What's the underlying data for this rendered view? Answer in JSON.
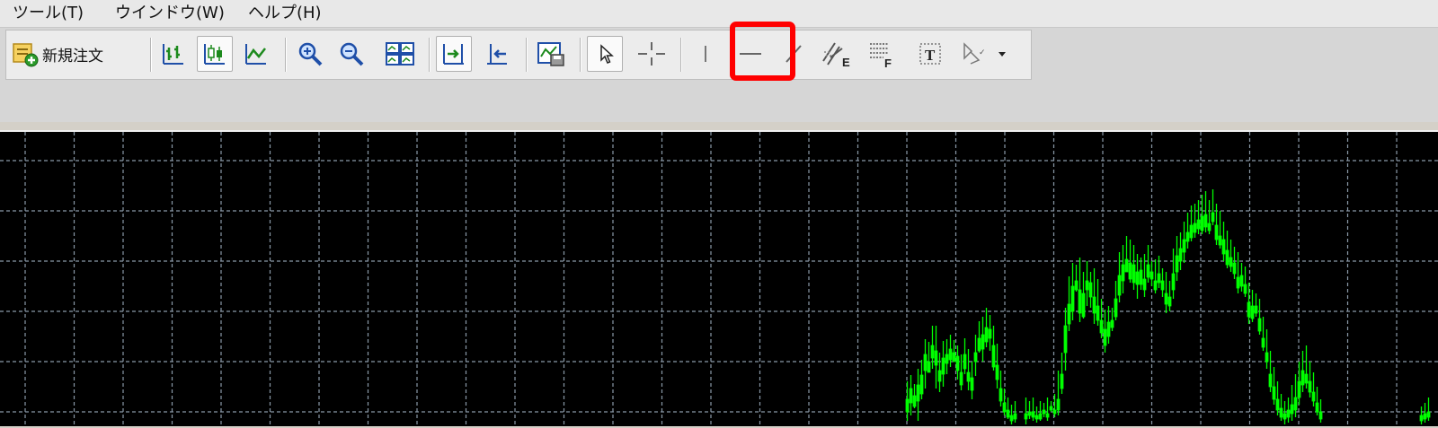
{
  "menu": {
    "items": [
      {
        "label": "ツール(T)"
      },
      {
        "label": "ウインドウ(W)"
      },
      {
        "label": "ヘルプ(H)"
      }
    ]
  },
  "toolbar": {
    "new_order_label": "新規注文",
    "buttons": [
      {
        "name": "bar-chart-icon",
        "pressed": false
      },
      {
        "name": "candlestick-chart-icon",
        "pressed": true
      },
      {
        "name": "line-chart-icon",
        "pressed": false
      },
      {
        "name": "zoom-in-icon",
        "pressed": false
      },
      {
        "name": "zoom-out-icon",
        "pressed": false
      },
      {
        "name": "tile-windows-icon",
        "pressed": false
      },
      {
        "name": "chart-shift-icon",
        "pressed": true
      },
      {
        "name": "auto-scroll-icon",
        "pressed": false
      },
      {
        "name": "templates-icon",
        "pressed": false
      },
      {
        "name": "cursor-icon",
        "pressed": true
      },
      {
        "name": "crosshair-icon",
        "pressed": false
      },
      {
        "name": "vertical-line-icon",
        "pressed": false
      },
      {
        "name": "horizontal-line-icon",
        "pressed": false,
        "highlighted": true
      },
      {
        "name": "trendline-icon",
        "pressed": false
      },
      {
        "name": "equidistant-channel-icon",
        "pressed": false
      },
      {
        "name": "fibonacci-retracement-icon",
        "pressed": false
      },
      {
        "name": "text-label-icon",
        "pressed": false
      },
      {
        "name": "arrows-dropdown-icon",
        "pressed": false
      }
    ]
  },
  "colors": {
    "chart_background": "#000000",
    "grid": "#8a99a8",
    "bull_candle": "#00ff00",
    "bear_candle": "#000000",
    "highlight": "#ff0000"
  },
  "chart": {
    "candles": [
      [
        1008,
        4,
        14,
        28,
        48
      ],
      [
        1012,
        10,
        24,
        40,
        55
      ],
      [
        1016,
        18,
        20,
        32,
        45
      ],
      [
        1020,
        4,
        26,
        44,
        62
      ],
      [
        1024,
        28,
        34,
        55,
        72
      ],
      [
        1028,
        40,
        60,
        78,
        95
      ],
      [
        1032,
        60,
        58,
        70,
        92
      ],
      [
        1036,
        62,
        74,
        88,
        110
      ],
      [
        1040,
        40,
        66,
        82,
        110
      ],
      [
        1044,
        36,
        48,
        60,
        80
      ],
      [
        1048,
        42,
        56,
        74,
        93
      ],
      [
        1052,
        56,
        68,
        78,
        95
      ],
      [
        1056,
        64,
        72,
        84,
        100
      ],
      [
        1060,
        70,
        70,
        80,
        94
      ],
      [
        1064,
        50,
        60,
        76,
        88
      ],
      [
        1068,
        38,
        44,
        58,
        78
      ],
      [
        1072,
        56,
        62,
        78,
        96
      ],
      [
        1076,
        38,
        48,
        58,
        84
      ],
      [
        1080,
        28,
        38,
        52,
        70
      ],
      [
        1084,
        54,
        70,
        80,
        100
      ],
      [
        1088,
        80,
        82,
        96,
        115
      ],
      [
        1092,
        70,
        84,
        100,
        120
      ],
      [
        1096,
        86,
        92,
        108,
        130
      ],
      [
        1100,
        82,
        96,
        106,
        122
      ],
      [
        1104,
        60,
        64,
        88,
        110
      ],
      [
        1108,
        40,
        50,
        66,
        90
      ],
      [
        1112,
        20,
        26,
        40,
        60
      ],
      [
        1116,
        10,
        14,
        24,
        40
      ],
      [
        1120,
        6,
        8,
        16,
        30
      ],
      [
        1124,
        0,
        4,
        10,
        22
      ],
      [
        1128,
        2,
        6,
        12,
        26
      ],
      [
        1140,
        0,
        6,
        12,
        30
      ],
      [
        1144,
        6,
        10,
        14,
        26
      ],
      [
        1148,
        4,
        8,
        14,
        30
      ],
      [
        1152,
        2,
        6,
        10,
        20
      ],
      [
        1156,
        4,
        6,
        12,
        26
      ],
      [
        1160,
        8,
        12,
        16,
        24
      ],
      [
        1164,
        4,
        8,
        12,
        30
      ],
      [
        1168,
        14,
        16,
        20,
        26
      ],
      [
        1172,
        8,
        12,
        16,
        34
      ],
      [
        1176,
        10,
        16,
        28,
        60
      ],
      [
        1180,
        34,
        40,
        56,
        80
      ],
      [
        1184,
        60,
        80,
        110,
        130
      ],
      [
        1188,
        104,
        112,
        134,
        165
      ],
      [
        1192,
        116,
        126,
        154,
        180
      ],
      [
        1196,
        148,
        150,
        160,
        178
      ],
      [
        1200,
        114,
        124,
        150,
        186
      ],
      [
        1204,
        118,
        120,
        146,
        170
      ],
      [
        1208,
        132,
        150,
        160,
        182
      ],
      [
        1212,
        130,
        142,
        158,
        170
      ],
      [
        1216,
        112,
        124,
        142,
        174
      ],
      [
        1220,
        110,
        116,
        132,
        162
      ],
      [
        1224,
        96,
        102,
        116,
        140
      ],
      [
        1228,
        80,
        88,
        106,
        128
      ],
      [
        1232,
        90,
        98,
        114,
        132
      ],
      [
        1236,
        104,
        108,
        116,
        130
      ],
      [
        1240,
        116,
        120,
        140,
        160
      ],
      [
        1244,
        136,
        144,
        166,
        192
      ],
      [
        1248,
        146,
        160,
        178,
        200
      ],
      [
        1252,
        170,
        170,
        184,
        210
      ],
      [
        1256,
        158,
        162,
        180,
        206
      ],
      [
        1260,
        150,
        158,
        178,
        200
      ],
      [
        1264,
        140,
        156,
        170,
        190
      ],
      [
        1268,
        150,
        156,
        172,
        186
      ],
      [
        1272,
        142,
        150,
        162,
        190
      ],
      [
        1276,
        158,
        164,
        178,
        200
      ],
      [
        1280,
        154,
        162,
        170,
        182
      ],
      [
        1284,
        146,
        150,
        160,
        184
      ],
      [
        1288,
        152,
        158,
        168,
        188
      ],
      [
        1292,
        142,
        150,
        160,
        174
      ],
      [
        1296,
        124,
        134,
        146,
        170
      ],
      [
        1300,
        126,
        132,
        142,
        160
      ],
      [
        1304,
        140,
        150,
        168,
        196
      ],
      [
        1308,
        160,
        170,
        188,
        210
      ],
      [
        1312,
        172,
        182,
        196,
        214
      ],
      [
        1316,
        180,
        192,
        206,
        226
      ],
      [
        1320,
        196,
        204,
        214,
        236
      ],
      [
        1324,
        204,
        208,
        222,
        244
      ],
      [
        1328,
        208,
        214,
        224,
        246
      ],
      [
        1332,
        212,
        218,
        228,
        250
      ],
      [
        1336,
        212,
        216,
        232,
        256
      ],
      [
        1340,
        214,
        220,
        234,
        260
      ],
      [
        1344,
        212,
        216,
        224,
        250
      ],
      [
        1348,
        222,
        226,
        236,
        262
      ],
      [
        1352,
        200,
        206,
        222,
        246
      ],
      [
        1356,
        196,
        200,
        210,
        238
      ],
      [
        1360,
        182,
        190,
        206,
        226
      ],
      [
        1364,
        174,
        178,
        194,
        216
      ],
      [
        1368,
        170,
        176,
        186,
        206
      ],
      [
        1372,
        162,
        168,
        180,
        198
      ],
      [
        1376,
        146,
        152,
        164,
        192
      ],
      [
        1380,
        148,
        154,
        166,
        180
      ],
      [
        1384,
        142,
        146,
        156,
        176
      ],
      [
        1388,
        112,
        120,
        136,
        158
      ],
      [
        1392,
        114,
        118,
        132,
        150
      ],
      [
        1396,
        120,
        124,
        132,
        146
      ],
      [
        1400,
        100,
        104,
        118,
        140
      ],
      [
        1404,
        82,
        86,
        96,
        120
      ],
      [
        1408,
        62,
        70,
        80,
        106
      ],
      [
        1412,
        36,
        42,
        56,
        82
      ],
      [
        1416,
        22,
        28,
        42,
        64
      ],
      [
        1420,
        10,
        16,
        28,
        48
      ],
      [
        1424,
        4,
        8,
        18,
        34
      ],
      [
        1428,
        0,
        6,
        12,
        26
      ],
      [
        1432,
        2,
        8,
        16,
        30
      ],
      [
        1436,
        4,
        12,
        22,
        44
      ],
      [
        1440,
        8,
        16,
        30,
        56
      ],
      [
        1444,
        22,
        30,
        48,
        70
      ],
      [
        1448,
        36,
        44,
        60,
        82
      ],
      [
        1452,
        40,
        46,
        56,
        88
      ],
      [
        1456,
        30,
        36,
        48,
        70
      ],
      [
        1460,
        20,
        26,
        36,
        58
      ],
      [
        1464,
        10,
        14,
        24,
        42
      ],
      [
        1468,
        2,
        6,
        14,
        28
      ],
      [
        1580,
        0,
        4,
        10,
        20
      ],
      [
        1584,
        2,
        6,
        12,
        24
      ],
      [
        1588,
        4,
        8,
        14,
        30
      ]
    ]
  }
}
